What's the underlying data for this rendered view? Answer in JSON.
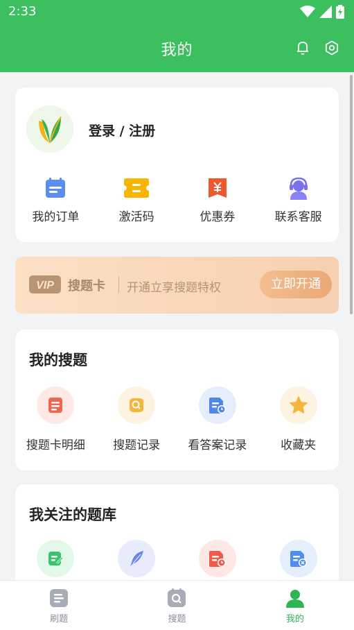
{
  "status_bar": {
    "time": "2:33"
  },
  "header": {
    "title": "我的",
    "bell_icon": "bell-icon",
    "settings_icon": "gear-icon"
  },
  "profile": {
    "login_label": "登录 / 注册",
    "actions": [
      {
        "label": "我的订单",
        "icon": "orders-icon",
        "color": "#5b8def"
      },
      {
        "label": "激活码",
        "icon": "ticket-icon",
        "color": "#f7b500"
      },
      {
        "label": "优惠券",
        "icon": "coupon-icon",
        "color": "#f0562b"
      },
      {
        "label": "联系客服",
        "icon": "support-icon",
        "color": "#7a6ff0"
      }
    ]
  },
  "vip": {
    "badge": "VIP",
    "name": "搜题卡",
    "description": "开通立享搜题特权",
    "button_label": "立即开通"
  },
  "my_search": {
    "title": "我的搜题",
    "items": [
      {
        "label": "搜题卡明细",
        "icon": "card-detail-icon",
        "color": "#f2654f",
        "bg": "#fdeae6"
      },
      {
        "label": "搜题记录",
        "icon": "search-record-icon",
        "color": "#f5b53a",
        "bg": "#fdf3e0"
      },
      {
        "label": "看答案记录",
        "icon": "answer-record-icon",
        "color": "#4f86ef",
        "bg": "#e6eefd"
      },
      {
        "label": "收藏夹",
        "icon": "star-icon",
        "color": "#f5b53a",
        "bg": "#fdf3e0"
      }
    ]
  },
  "followed_banks": {
    "title": "我关注的题库",
    "items": [
      {
        "icon": "note-edit-icon",
        "color": "#38c46a",
        "bg": "#e3f8e8"
      },
      {
        "icon": "feather-icon",
        "color": "#6b82e8",
        "bg": "#e7ebfc"
      },
      {
        "icon": "doc-clock-icon",
        "color": "#ef5b4a",
        "bg": "#fde8e5"
      },
      {
        "icon": "doc-x-icon",
        "color": "#4f8ef0",
        "bg": "#e5eefd"
      }
    ]
  },
  "tabbar": {
    "tabs": [
      {
        "label": "刷题",
        "icon": "list-icon",
        "active": false
      },
      {
        "label": "搜题",
        "icon": "search-icon",
        "active": false
      },
      {
        "label": "我的",
        "icon": "user-icon",
        "active": true
      }
    ]
  }
}
